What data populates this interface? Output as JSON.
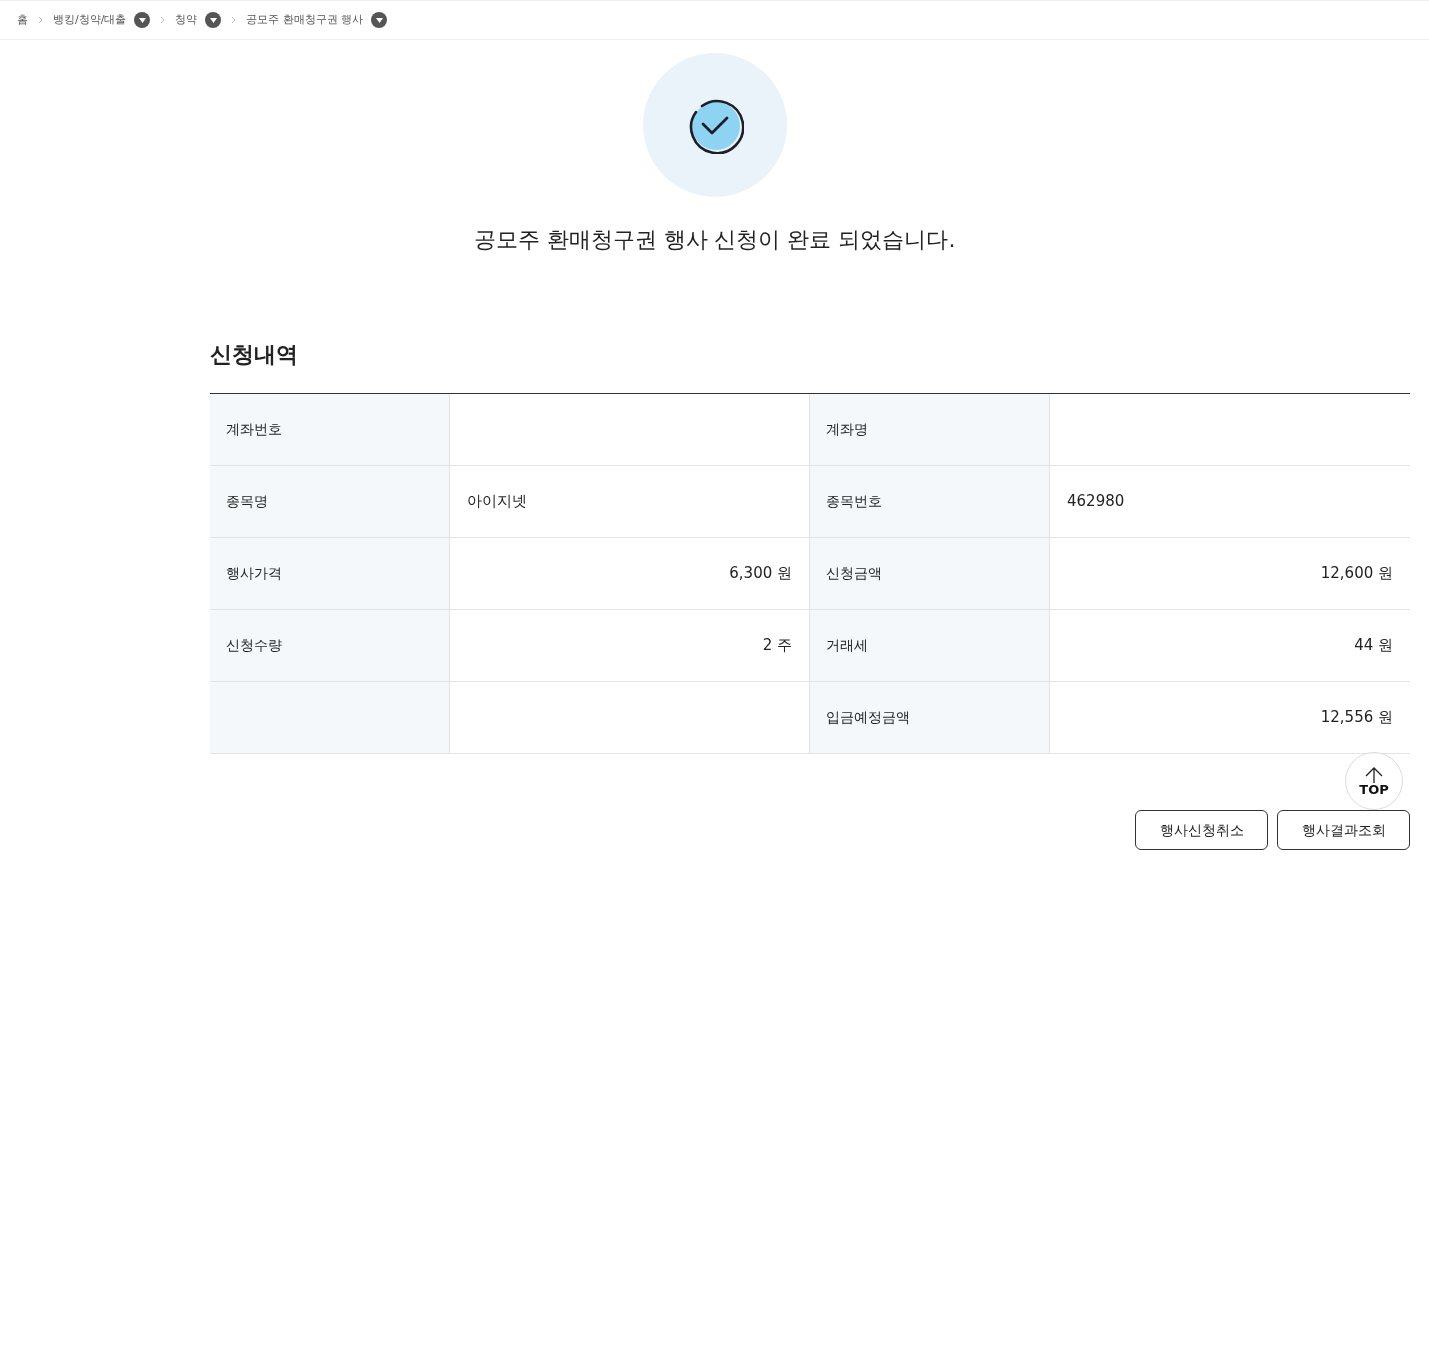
{
  "breadcrumb": [
    {
      "label": "홈",
      "dropdown": false
    },
    {
      "label": "뱅킹/청약/대출",
      "dropdown": true
    },
    {
      "label": "청약",
      "dropdown": true
    },
    {
      "label": "공모주 환매청구권 행사",
      "dropdown": true
    }
  ],
  "message": "공모주 환매청구권 행사 신청이 완료 되었습니다.",
  "section_title": "신청내역",
  "table": {
    "rows": [
      [
        {
          "label": "계좌번호"
        },
        {
          "label": "계좌명"
        }
      ],
      [
        {
          "label": "종목명",
          "value": "아이지넷",
          "kind": "text"
        },
        {
          "label": "종목번호",
          "value": "462980",
          "kind": "text"
        }
      ],
      [
        {
          "label": "행사가격",
          "value": "6,300 원",
          "kind": "amount"
        },
        {
          "label": "신청금액",
          "value": "12,600 원",
          "kind": "amount"
        }
      ],
      [
        {
          "label": "신청수량",
          "value": "2 주",
          "kind": "amount"
        },
        {
          "label": "거래세",
          "value": "44 원",
          "kind": "amount"
        }
      ],
      [
        {},
        {
          "label": "입금예정금액",
          "value": "12,556 원",
          "kind": "amount"
        }
      ]
    ]
  },
  "buttons": [
    "행사신청취소",
    "행사결과조회"
  ],
  "top_button": "TOP"
}
